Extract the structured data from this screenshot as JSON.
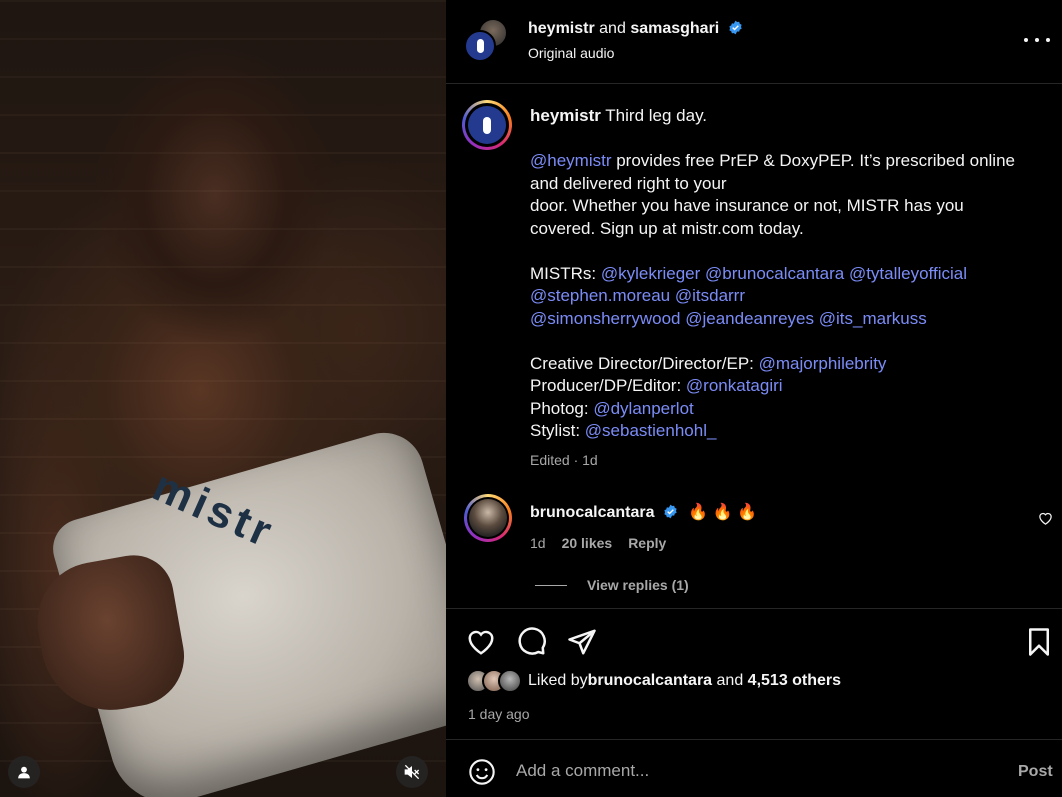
{
  "header": {
    "user1": "heymistr",
    "and": "and",
    "user2": "samasghari",
    "subtitle": "Original audio"
  },
  "media": {
    "towel_text": "mistr"
  },
  "caption": {
    "username": "heymistr",
    "line1": "Third leg day.",
    "p2_mention": "@heymistr",
    "p2_text_a": " provides free PrEP & DoxyPEP. It’s prescribed online",
    "p2_text_b": "and delivered right to your",
    "p2_text_c": "door. Whether you have insurance or not, MISTR has you",
    "p2_text_d": "covered. Sign up at mistr.com today.",
    "mistrs_label": "MISTRs: ",
    "mistrs": [
      "@kylekrieger",
      "@brunocalcantara",
      "@tytalleyofficial",
      "@stephen.moreau",
      "@itsdarrr",
      "@simonsherrywood",
      "@jeandeanreyes",
      "@its_markuss"
    ],
    "credits": [
      {
        "label": "Creative Director/Director/EP: ",
        "handle": "@majorphilebrity"
      },
      {
        "label": "Producer/DP/Editor: ",
        "handle": "@ronkatagiri"
      },
      {
        "label": "Photog: ",
        "handle": "@dylanperlot"
      },
      {
        "label": "Stylist: ",
        "handle": "@sebastienhohl_"
      }
    ],
    "edited": "Edited · 1d"
  },
  "comment": {
    "username": "brunocalcantara",
    "text": "🔥 🔥 🔥",
    "time": "1d",
    "likes": "20 likes",
    "reply": "Reply",
    "view_replies": "View replies (1)"
  },
  "likes": {
    "prefix": "Liked by ",
    "user": "brunocalcantara",
    "middle": " and ",
    "count": "4,513 others",
    "time_ago": "1 day ago"
  },
  "comment_box": {
    "placeholder": "Add a comment...",
    "post": "Post"
  },
  "icons": [
    "user-icon",
    "muted-speaker-icon",
    "more-icon",
    "verified-icon",
    "heart-icon",
    "comment-icon",
    "share-icon",
    "bookmark-icon",
    "emoji-icon"
  ],
  "colors": {
    "mention": "#7b8cf7",
    "verified": "#3897f0",
    "muted_text": "#a8a8a8"
  }
}
